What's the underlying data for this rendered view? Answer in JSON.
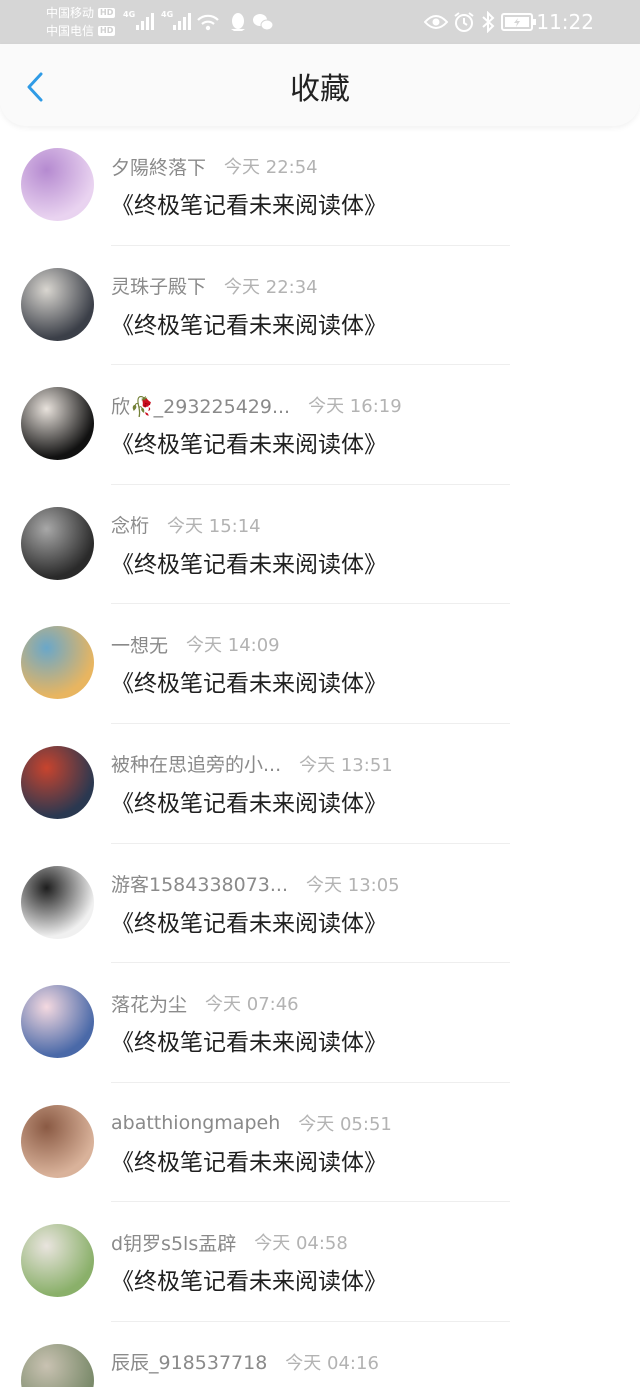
{
  "status_bar": {
    "carrier1": "中国移动",
    "carrier2": "中国电信",
    "hd_badge": "HD",
    "network1": "4G",
    "network2": "4G",
    "time": "11:22",
    "icons": [
      "wifi-icon",
      "qq-icon",
      "wechat-icon",
      "eye-icon",
      "alarm-icon",
      "bluetooth-icon",
      "battery-icon"
    ]
  },
  "header": {
    "title": "收藏",
    "back_icon": "chevron-left-icon",
    "accent_color": "#2f9be6"
  },
  "favorites": [
    {
      "name": "夕陽終落下",
      "time": "今天 22:54",
      "title": "《终极笔记看未来阅读体》",
      "avatar_colors": [
        "#e9d3f0",
        "#b58ad0"
      ]
    },
    {
      "name": "灵珠子殿下",
      "time": "今天 22:34",
      "title": "《终极笔记看未来阅读体》",
      "avatar_colors": [
        "#3b3f48",
        "#d9d6d0"
      ]
    },
    {
      "name": "欣🥀_293225429...",
      "time": "今天 16:19",
      "title": "《终极笔记看未来阅读体》",
      "avatar_colors": [
        "#111111",
        "#e8e2dc"
      ]
    },
    {
      "name": "念桁",
      "time": "今天 15:14",
      "title": "《终极笔记看未来阅读体》",
      "avatar_colors": [
        "#2a2a2a",
        "#a8a8a8"
      ]
    },
    {
      "name": "一想无",
      "time": "今天 14:09",
      "title": "《终极笔记看未来阅读体》",
      "avatar_colors": [
        "#e8b560",
        "#6aa7c9"
      ]
    },
    {
      "name": "被种在思追旁的小...",
      "time": "今天 13:51",
      "title": "《终极笔记看未来阅读体》",
      "avatar_colors": [
        "#2a3850",
        "#c8442e"
      ]
    },
    {
      "name": "游客1584338073...",
      "time": "今天 13:05",
      "title": "《终极笔记看未来阅读体》",
      "avatar_colors": [
        "#f0f0f0",
        "#1e1e1e"
      ]
    },
    {
      "name": "落花为尘",
      "time": "今天 07:46",
      "title": "《终极笔记看未来阅读体》",
      "avatar_colors": [
        "#4a69a8",
        "#f4d9e0"
      ]
    },
    {
      "name": "abatthiongmapeh",
      "time": "今天 05:51",
      "title": "《终极笔记看未来阅读体》",
      "avatar_colors": [
        "#d9b29a",
        "#8a5a44"
      ]
    },
    {
      "name": "d钥罗s5ls盂辟",
      "time": "今天 04:58",
      "title": "《终极笔记看未来阅读体》",
      "avatar_colors": [
        "#8ab06a",
        "#e9e4de"
      ]
    },
    {
      "name": "辰辰_918537718",
      "time": "今天 04:16",
      "title": "",
      "avatar_colors": [
        "#7a8a6a",
        "#c9c2b2"
      ]
    }
  ]
}
